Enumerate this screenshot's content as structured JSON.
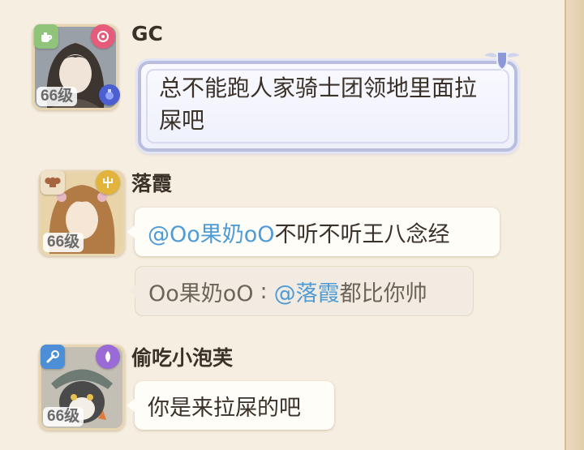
{
  "messages": [
    {
      "name": "GC",
      "level": "66级",
      "text": "总不能跑人家骑士团领地里面拉屎吧"
    },
    {
      "name": "落霞",
      "level": "66级",
      "mention": "@Oo果奶oO",
      "text": "不听不听王八念经",
      "reply": {
        "author": "Oo果奶oO",
        "separator": ":",
        "mention": "@落霞",
        "text": "都比你帅"
      }
    },
    {
      "name": "偷吃小泡芙",
      "level": "66级",
      "text": "你是来拉屎的吧"
    }
  ],
  "icons": {
    "msg1_badge_left": "teapot-icon",
    "msg1_badge_right": "pink-gem-icon",
    "msg2_badge_left": "chef-hat-icon",
    "msg2_badge_right": "gold-trident-icon",
    "msg3_badge_left": "wrench-icon",
    "msg3_badge_right": "purple-orb-icon"
  },
  "colors": {
    "mention": "#4f9bd6",
    "background": "#f6eee0"
  }
}
